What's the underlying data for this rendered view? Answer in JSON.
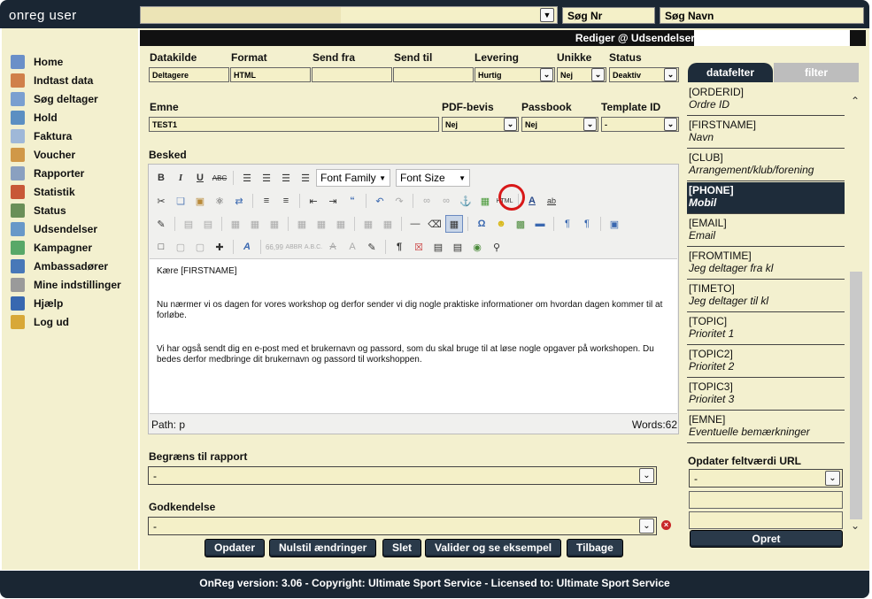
{
  "app": {
    "brand": "onreg user",
    "search_nr_label": "Søg Nr",
    "search_name_label": "Søg Navn"
  },
  "sidebar": {
    "items": [
      {
        "label": "Home",
        "icon": "home-icon",
        "color": "#6a8fc8"
      },
      {
        "label": "Indtast data",
        "icon": "add-data-icon",
        "color": "#d0804a"
      },
      {
        "label": "Søg deltager",
        "icon": "search-user-icon",
        "color": "#7a9fd0"
      },
      {
        "label": "Hold",
        "icon": "team-icon",
        "color": "#5b8fc2"
      },
      {
        "label": "Faktura",
        "icon": "invoice-icon",
        "color": "#9fb8d8"
      },
      {
        "label": "Voucher",
        "icon": "gift-icon",
        "color": "#d09848"
      },
      {
        "label": "Rapporter",
        "icon": "report-icon",
        "color": "#8aa0c0"
      },
      {
        "label": "Statistik",
        "icon": "chart-icon",
        "color": "#c85838"
      },
      {
        "label": "Status",
        "icon": "status-icon",
        "color": "#6a8f58"
      },
      {
        "label": "Udsendelser",
        "icon": "broadcast-icon",
        "color": "#6898c8"
      },
      {
        "label": "Kampagner",
        "icon": "campaign-icon",
        "color": "#58a868"
      },
      {
        "label": "Ambassadører",
        "icon": "ambassador-icon",
        "color": "#4878b8"
      },
      {
        "label": "Mine indstillinger",
        "icon": "settings-icon",
        "color": "#9a9a9a"
      },
      {
        "label": "Hjælp",
        "icon": "help-icon",
        "color": "#3868b0"
      },
      {
        "label": "Log ud",
        "icon": "logout-icon",
        "color": "#d8a838"
      }
    ]
  },
  "header": {
    "title": "Rediger @ Udsendelser @"
  },
  "form": {
    "datakilde": {
      "label": "Datakilde",
      "value": "Deltagere"
    },
    "format": {
      "label": "Format",
      "value": "HTML"
    },
    "send_fra": {
      "label": "Send fra",
      "value": ""
    },
    "send_til": {
      "label": "Send til",
      "value": ""
    },
    "levering": {
      "label": "Levering",
      "value": "Hurtig"
    },
    "unikke": {
      "label": "Unikke",
      "value": "Nej"
    },
    "status": {
      "label": "Status",
      "value": "Deaktiv"
    },
    "emne": {
      "label": "Emne",
      "value": "TEST1"
    },
    "pdf_bevis": {
      "label": "PDF-bevis",
      "value": "Nej"
    },
    "passbook": {
      "label": "Passbook",
      "value": "Nej"
    },
    "template_id": {
      "label": "Template ID",
      "value": "-"
    },
    "besked_label": "Besked"
  },
  "editor": {
    "font_family": "Font Family",
    "font_size": "Font Size",
    "paragraphs": [
      "Kære [FIRSTNAME]",
      "Nu nærmer vi os dagen for vores workshop og derfor sender vi dig nogle praktiske informationer om hvordan dagen kommer til at forløbe.",
      "Vi har også sendt dig en e-post med et brukernavn og passord, som du skal bruge til at løse nogle opgaver på workshopen. Du bedes derfor medbringe dit brukernavn og passord til workshoppen."
    ],
    "path": "Path: p",
    "words": "Words:62"
  },
  "limit": {
    "label": "Begræns til rapport",
    "value": "-"
  },
  "approval": {
    "label": "Godkendelse",
    "value": "-"
  },
  "buttons": {
    "update": "Opdater",
    "reset": "Nulstil ændringer",
    "delete": "Slet",
    "validate": "Valider og se eksempel",
    "back": "Tilbage"
  },
  "right_panel": {
    "tab_fields": "datafelter",
    "tab_filter": "filter",
    "fields": [
      {
        "code": "[ORDERID]",
        "desc": "Ordre ID"
      },
      {
        "code": "[FIRSTNAME]",
        "desc": "Navn"
      },
      {
        "code": "[CLUB]",
        "desc": "Arrangement/klub/forening"
      },
      {
        "code": "[PHONE]",
        "desc": "Mobil"
      },
      {
        "code": "[EMAIL]",
        "desc": "Email"
      },
      {
        "code": "[FROMTIME]",
        "desc": "Jeg deltager fra kl"
      },
      {
        "code": "[TIMETO]",
        "desc": "Jeg deltager til kl"
      },
      {
        "code": "[TOPIC]",
        "desc": "Prioritet 1"
      },
      {
        "code": "[TOPIC2]",
        "desc": "Prioritet 2"
      },
      {
        "code": "[TOPIC3]",
        "desc": "Prioritet 3"
      },
      {
        "code": "[EMNE]",
        "desc": "Eventuelle bemærkninger"
      }
    ],
    "url_label": "Opdater feltværdi URL",
    "url_select": "-",
    "create_button": "Opret"
  },
  "footer": {
    "text": "OnReg version: 3.06 - Copyright: Ultimate Sport Service - Licensed to: Ultimate Sport Service"
  }
}
